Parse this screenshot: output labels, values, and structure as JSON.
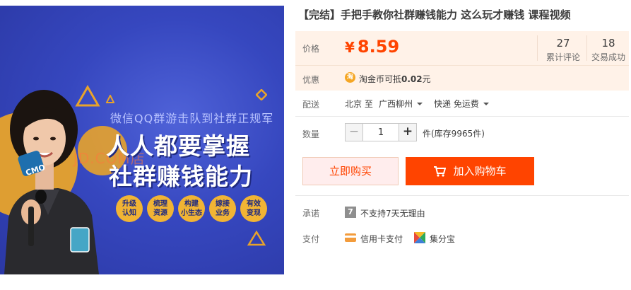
{
  "product": {
    "title": "【完结】手把手教你社群赚钱能力 这么玩才赚钱 课程视频"
  },
  "banner": {
    "subtitle": "微信QQ群游击队到社群正规军",
    "headline_line1": "人人都要掌握",
    "headline_line2": "社群赚钱能力",
    "watermark": "JD.COM店",
    "badges": [
      "升级\n认知",
      "梳理\n资源",
      "构建\n小生态",
      "嫁接\n业务",
      "有效\n变现"
    ],
    "person_badge_text": "CMO",
    "colors": {
      "background": "#3647bf",
      "accent": "#e8a32b"
    }
  },
  "price": {
    "label": "价格",
    "currency": "¥",
    "value": "8.59",
    "color": "#ff4400",
    "reviews_count": "27",
    "reviews_label": "累计评论",
    "transactions_count": "18",
    "transactions_label": "交易成功"
  },
  "promo": {
    "label": "优惠",
    "icon_text": "淘",
    "text_prefix": "淘金币可抵",
    "amount": "0.02",
    "unit": "元"
  },
  "shipping": {
    "label": "配送",
    "from": "北京 至",
    "to": "广西柳州",
    "method": "快递 免运费"
  },
  "quantity": {
    "label": "数量",
    "minus": "−",
    "plus": "+",
    "value": "1",
    "stock_text": "件(库存9965件)"
  },
  "actions": {
    "buy_now": "立即购买",
    "add_to_cart": "加入购物车"
  },
  "service": {
    "promise_label": "承诺",
    "promise_icon": "7",
    "promise_text": "不支持7天无理由",
    "payment_label": "支付",
    "payment_methods": [
      "信用卡支付",
      "集分宝"
    ]
  }
}
